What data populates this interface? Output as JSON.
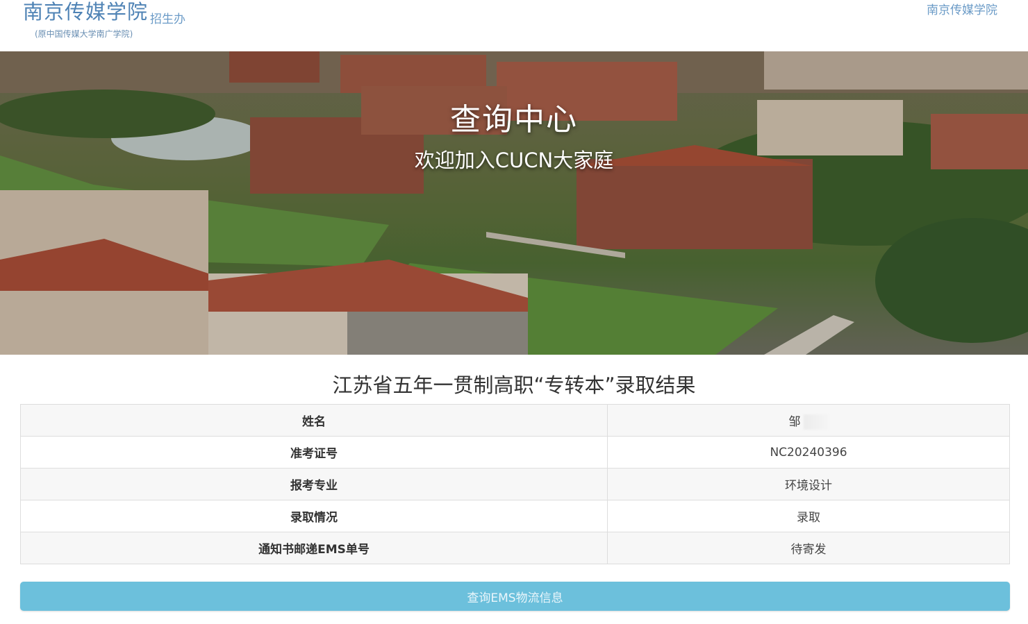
{
  "header": {
    "school_name": "南京传媒学院",
    "office": "招生办",
    "former_name": "(原中国传媒大学南广学院)",
    "top_link": "南京传媒学院"
  },
  "hero": {
    "title": "查询中心",
    "subtitle": "欢迎加入CUCN大家庭"
  },
  "result": {
    "title": "江苏省五年一贯制高职“专转本”录取结果",
    "rows": [
      {
        "label": "姓名",
        "value": "邹"
      },
      {
        "label": "准考证号",
        "value": "NC20240396"
      },
      {
        "label": "报考专业",
        "value": "环境设计"
      },
      {
        "label": "录取情况",
        "value": "录取"
      },
      {
        "label": "通知书邮递EMS单号",
        "value": "待寄发"
      }
    ]
  },
  "actions": {
    "ems_button": "查询EMS物流信息"
  },
  "colors": {
    "brand_blue": "#4f83b5",
    "button_bg": "#6cc0dc"
  }
}
